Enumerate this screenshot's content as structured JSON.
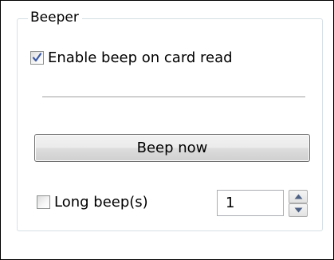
{
  "group": {
    "title": "Beeper"
  },
  "enable_beep": {
    "label": "Enable beep on card read",
    "checked": true
  },
  "beep_button": {
    "label": "Beep now"
  },
  "long_beep": {
    "label": "Long beep(s)",
    "checked": false,
    "count": "1"
  },
  "icons": {
    "check": "checkmark-icon",
    "spin_up": "arrow-up-icon",
    "spin_down": "arrow-down-icon"
  },
  "colors": {
    "check_mark": "#3b5aa6",
    "groupbox_border": "#d5dfe5",
    "spin_arrow": "#4d6185"
  }
}
